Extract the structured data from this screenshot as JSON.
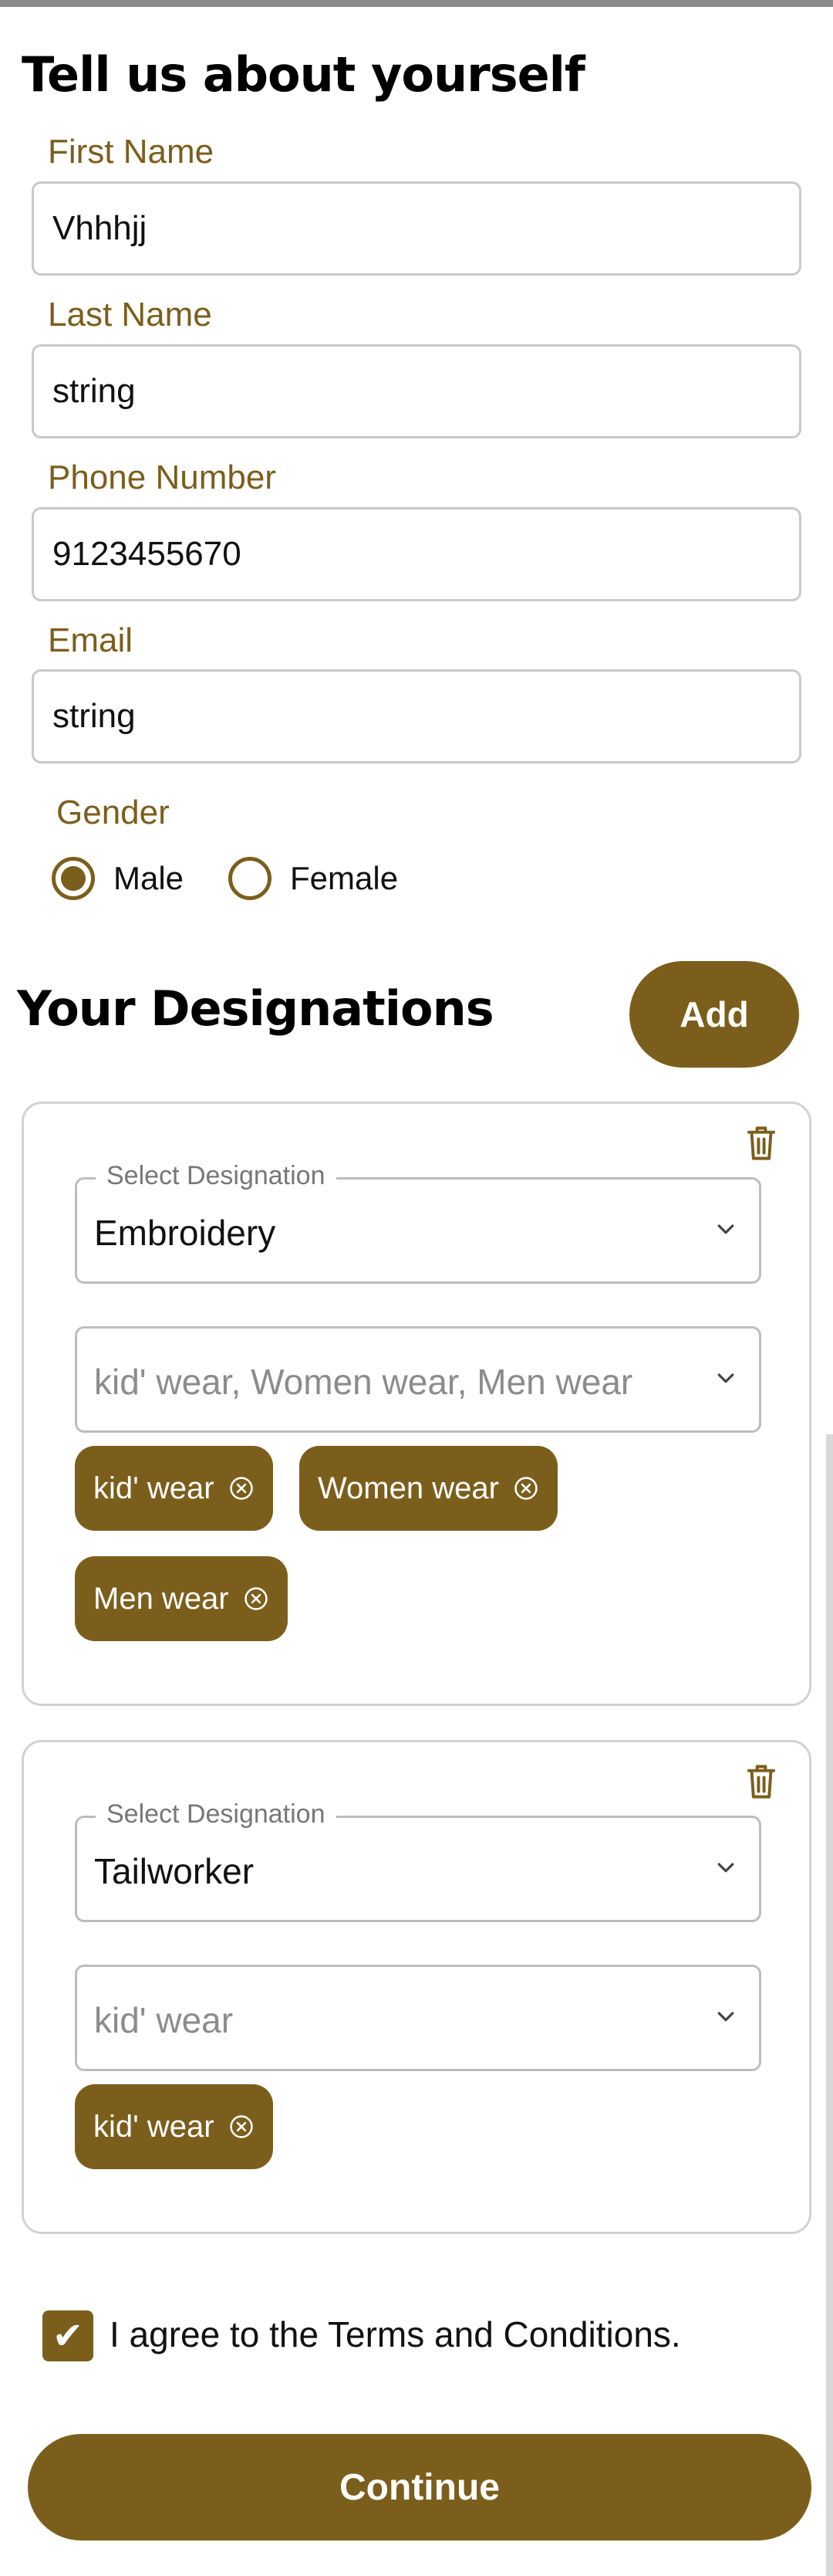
{
  "header": {
    "title": "Tell us about yourself"
  },
  "form": {
    "first_name": {
      "label": "First Name",
      "value": "Vhhhjj"
    },
    "last_name": {
      "label": "Last Name",
      "value": "string"
    },
    "phone": {
      "label": "Phone Number",
      "value": "9123455670"
    },
    "email": {
      "label": "Email",
      "value": "string"
    },
    "gender": {
      "label": "Gender",
      "options": [
        "Male",
        "Female"
      ],
      "selected": "Male"
    }
  },
  "designations": {
    "title": "Your Designations",
    "add_label": "Add",
    "select_legend": "Select Designation",
    "cards": [
      {
        "designation": "Embroidery",
        "categories_summary": "kid' wear, Women wear, Men wear",
        "chips": [
          "kid' wear",
          "Women wear",
          "Men wear"
        ]
      },
      {
        "designation": "Tailworker",
        "categories_summary": "kid' wear",
        "chips": [
          "kid' wear"
        ]
      }
    ]
  },
  "terms": {
    "label": "I agree to the Terms and Conditions.",
    "checked": true,
    "check_glyph": "✔"
  },
  "footer": {
    "continue_label": "Continue"
  },
  "colors": {
    "accent": "#7c5e1c",
    "label": "#7c5e1c",
    "border": "#c9c9c9"
  },
  "icons": {
    "delete": "trash-icon",
    "dropdown": "chevron-down-icon",
    "chip_remove": "close-circle-icon",
    "checkbox": "checkmark-icon"
  }
}
